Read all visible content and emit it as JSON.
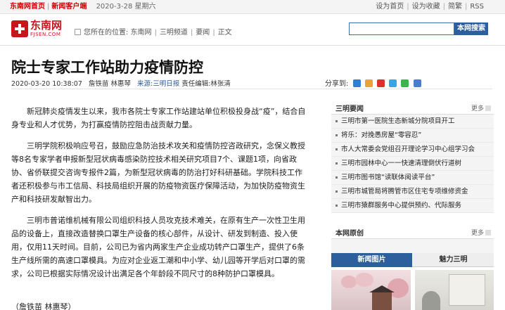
{
  "topbar": {
    "home_link": "东南网首页",
    "client_link": "新闻客户端",
    "date": "2020-3-28 星期六",
    "right_links": [
      "设为首页",
      "设为收藏",
      "简繁",
      "RSS"
    ]
  },
  "header": {
    "logo_text": "东南网",
    "logo_sub": "FJSEN.COM",
    "location_label": "您所在的位置:",
    "breadcrumbs": [
      "东南网",
      "三明频道",
      "要闻",
      "正文"
    ],
    "search_button": "本网搜索"
  },
  "article": {
    "title": "院士专家工作站助力疫情防控",
    "datetime": "2020-03-20 10:38:07",
    "authors": "詹铁苗 林惠琴",
    "source": "来源:三明日报",
    "editor": "责任编辑:林张清",
    "share_label": "分享到:",
    "paragraphs": [
      "新冠肺炎疫情发生以来，我市各院士专家工作站建站单位积极投身战“疫”，结合自身专业和人才优势，为打赢疫情防控阻击战贡献力量。",
      "三明学院积极响应号召，鼓励应急防治技术攻关和疫情防控咨政研究，念保义教授等8名专家学者申报新型冠状病毒感染防控技术相关研究项目7个、课题1项，向省政协、省侨联提交咨询专报件2篇，为新型冠状病毒的防治打好科研基础。学院科技工作者还积极参与市工信局、科技局组织开展的防疫物资医疗保障活动，为加快防疫物资生产和科技研发献智出力。",
      "三明市普诺维机械有限公司组织科技人员攻克技术难关，在原有生产一次性卫生用品的设备上，直接改造替换口罩生产设备的核心部件，从设计、研发到制造、投入使用，仅用11天时间。目前，公司已为省内两家生产企业成功转产口罩生产，提供了6条生产线所需的高速口罩模具。为应对企业返工潮和中小学、幼儿园等开学后对口罩的需求，公司已根据实际情况设计出满足各个年龄段不同尺寸的8种防护口罩模具。"
    ],
    "byline": "（詹铁苗 林惠琴）"
  },
  "sidebar": {
    "news_title": "三明要闻",
    "more_label": "更多",
    "news_items": [
      "三明市第一医院生态新城分院项目开工",
      "将乐：对挽愚房屋“零容忍”",
      "市人大常委会党组召开理论学习中心组学习会",
      "三明市园林中心一一快速清理倒伏行道树",
      "三明市图书馆“读联体阅读平台”",
      "三明市城管局将腾管市区住宅专项维修资金",
      "三明市猿群服务中心提供预约、代际服务"
    ],
    "original_title": "本网原创",
    "tabs": [
      "新闻图片",
      "魅力三明"
    ]
  }
}
